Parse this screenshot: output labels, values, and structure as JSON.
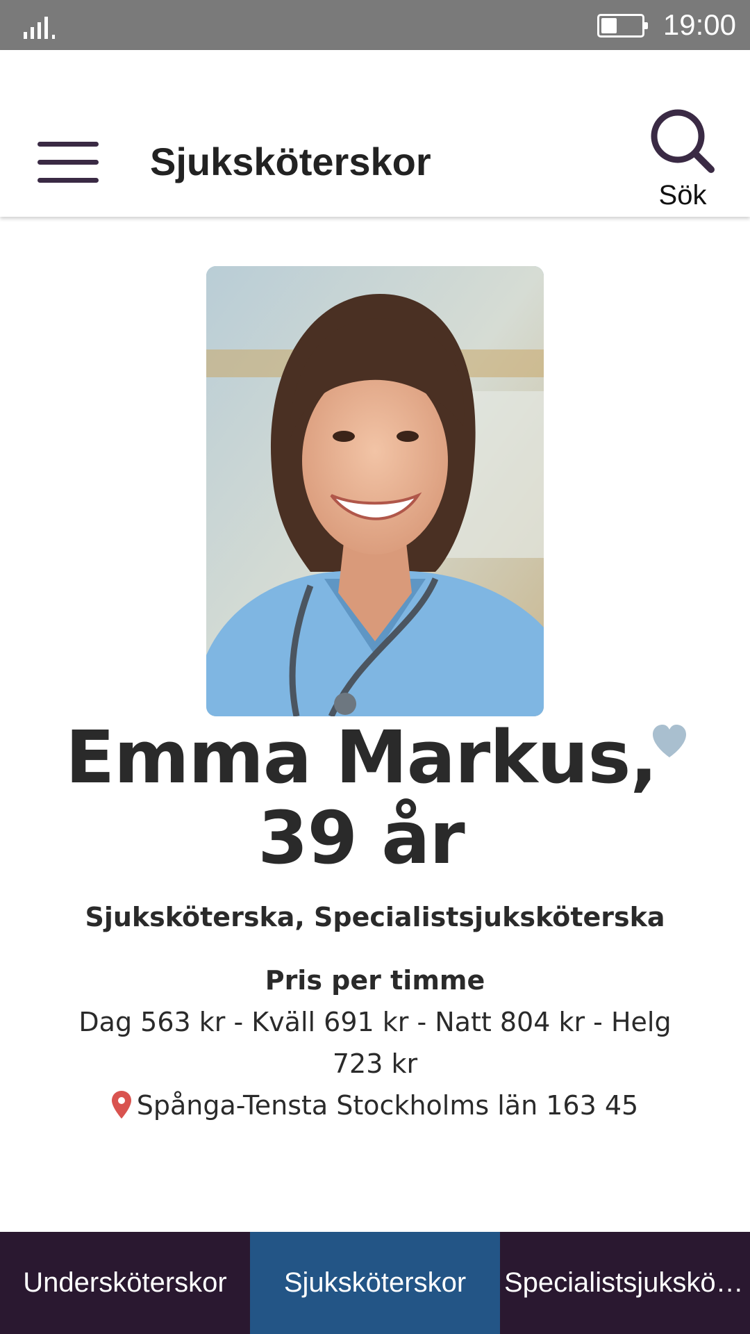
{
  "status_bar": {
    "time": "19:00",
    "battery_level": 0.4
  },
  "header": {
    "title": "Sjuksköterskor",
    "search_label": "Sök",
    "menu_icon": "hamburger-menu-icon",
    "search_icon": "magnifier-icon"
  },
  "profile": {
    "name": "Emma Markus,",
    "age": "39 år",
    "profession": "Sjuksköterska, Specialistsjuksköterska",
    "price_heading": "Pris per timme",
    "price_list": "Dag 563 kr - Kväll 691 kr - Natt 804 kr - Helg 723 kr",
    "location": "Spånga-Tensta Stockholms län 163 45",
    "favorite_icon": "heart-icon",
    "location_icon": "map-pin-icon"
  },
  "tabs": [
    {
      "label": "Undersköterskor",
      "active": false
    },
    {
      "label": "Sjuksköterskor",
      "active": true
    },
    {
      "label": "Specialistsjuksköterskor",
      "active": false
    }
  ],
  "colors": {
    "status_bar": "#7a7a7a",
    "header_icon": "#3a2a44",
    "tab_bar": "#2a1830",
    "tab_active": "#235586",
    "heart": "#a9bfcf",
    "pin": "#d9534f"
  }
}
